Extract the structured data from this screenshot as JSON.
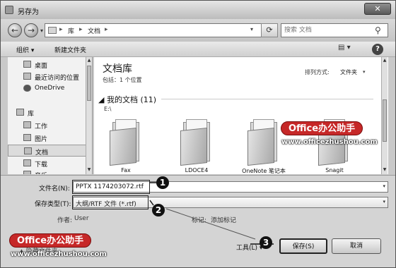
{
  "window": {
    "title": "另存为",
    "close_label": "✕"
  },
  "address": {
    "crumbs": [
      "库",
      "文档"
    ],
    "separators": [
      "▸",
      "▸",
      "▸"
    ],
    "search_placeholder": "搜索 文档"
  },
  "toolbar": {
    "organize_label": "组织 ▾",
    "new_folder_label": "新建文件夹",
    "help_label": "?"
  },
  "sidebar": {
    "items": [
      {
        "label": "桌面",
        "icon": "desktop-icon"
      },
      {
        "label": "最近访问的位置",
        "icon": "recent-places-icon"
      },
      {
        "label": "OneDrive",
        "icon": "cloud-icon"
      },
      {
        "label": "库",
        "icon": "library-icon"
      },
      {
        "label": "工作",
        "icon": "folder-icon"
      },
      {
        "label": "图片",
        "icon": "pictures-icon"
      },
      {
        "label": "文档",
        "icon": "documents-icon"
      },
      {
        "label": "下载",
        "icon": "downloads-icon"
      },
      {
        "label": "音乐",
        "icon": "music-icon"
      }
    ],
    "selected": "文档"
  },
  "library": {
    "title": "文档库",
    "subtitle": "包括：1 个位置",
    "arrange_label": "排列方式:",
    "arrange_value": "文件夹",
    "group_title": "我的文档 (11)",
    "group_path": "E:\\",
    "items": [
      {
        "label": "Fax"
      },
      {
        "label": "LDOCE4"
      },
      {
        "label": "OneNote 笔记本"
      },
      {
        "label": "Snagit"
      }
    ]
  },
  "form": {
    "filename_label": "文件名(N):",
    "filename_value": "PPTX 1174203072.rtf",
    "filetype_label": "保存类型(T):",
    "filetype_value": "大纲/RTF 文件 (*.rtf)",
    "author_label": "作者:",
    "author_value": "User",
    "tags_label": "标记:",
    "tags_value": "添加标记",
    "hide_folders_label": "▲ 隐藏文件夹"
  },
  "buttons": {
    "tools_label": "工具(L) ▾",
    "save_label": "保存(S)",
    "cancel_label": "取消"
  },
  "annotations": {
    "markers": [
      "1",
      "2",
      "3"
    ]
  },
  "watermark": {
    "badge": "Office办公助手",
    "url": "www.officezhushou.com"
  },
  "colors": {
    "badge": "#c62828",
    "selection": "#dcdcdc",
    "window": "#c9c9c9"
  }
}
